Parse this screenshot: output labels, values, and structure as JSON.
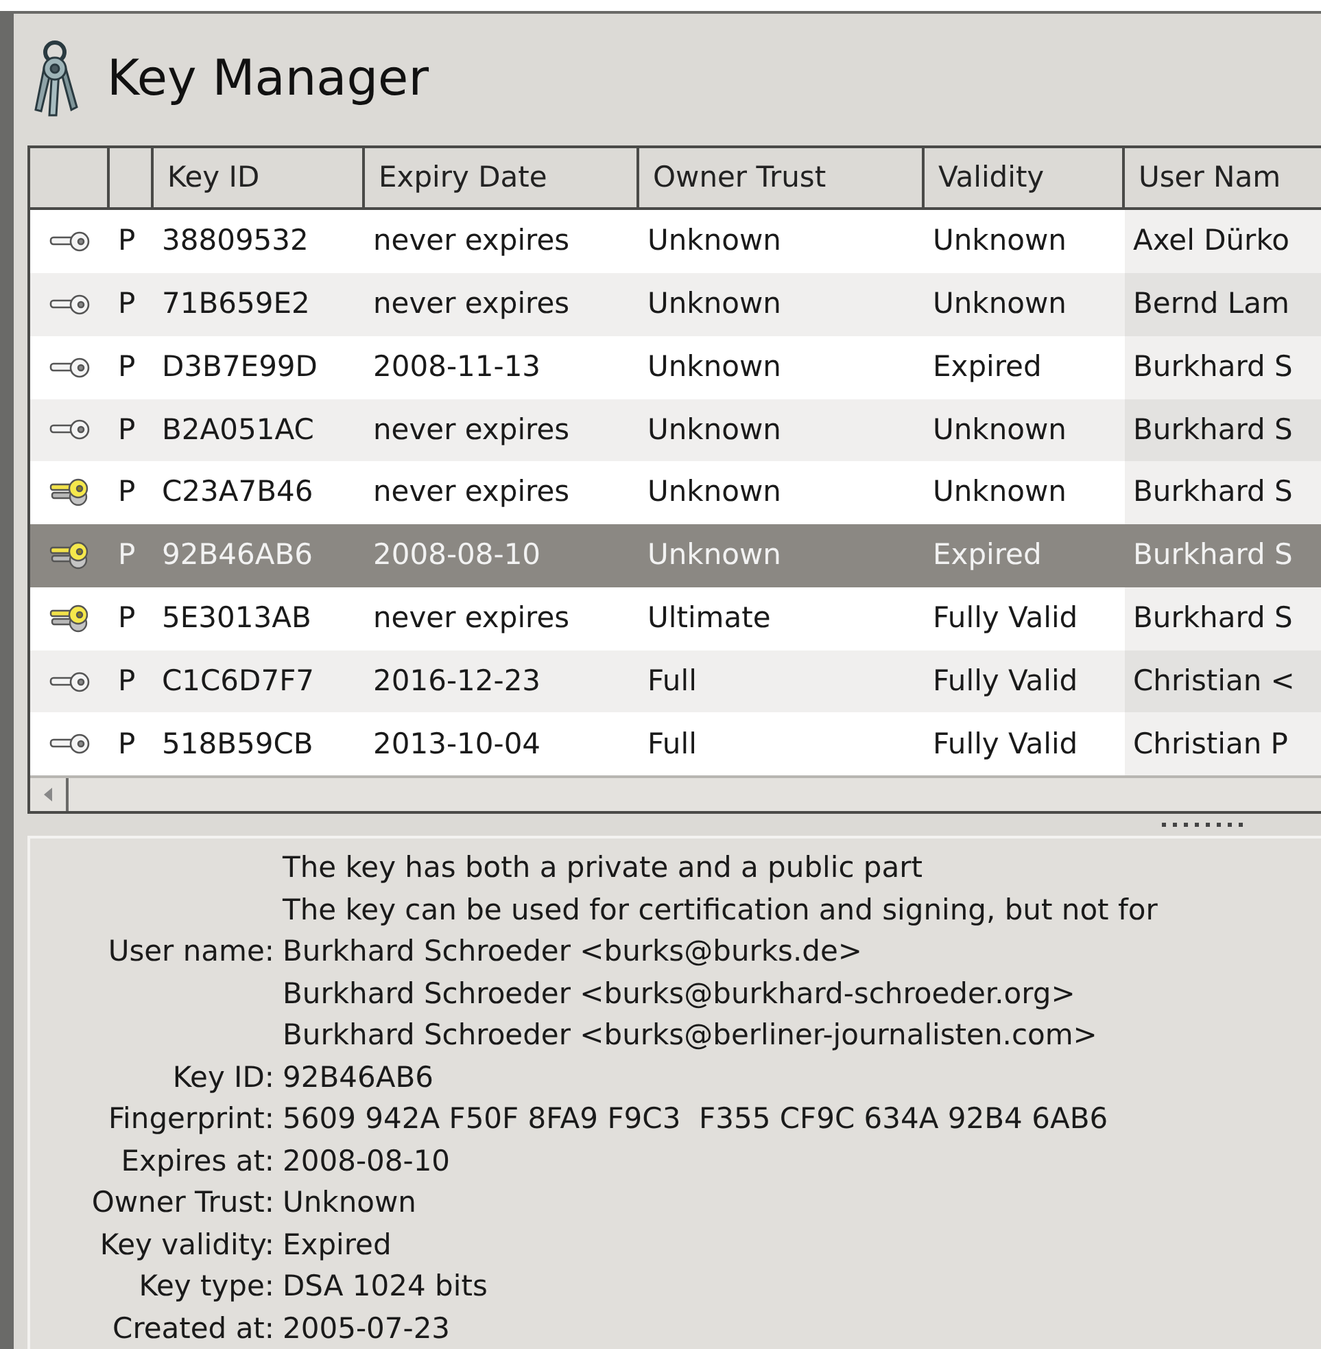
{
  "window": {
    "title": "Key Manager"
  },
  "table": {
    "columns": [
      "Key ID",
      "Expiry Date",
      "Owner Trust",
      "Validity",
      "User Nam"
    ],
    "rows": [
      {
        "kind": "public",
        "type": "P",
        "key_id": "38809532",
        "expiry": "never expires",
        "owner_trust": "Unknown",
        "validity": "Unknown",
        "user_name": "Axel Dürko",
        "selected": false
      },
      {
        "kind": "public",
        "type": "P",
        "key_id": "71B659E2",
        "expiry": "never expires",
        "owner_trust": "Unknown",
        "validity": "Unknown",
        "user_name": "Bernd Lam",
        "selected": false
      },
      {
        "kind": "public",
        "type": "P",
        "key_id": "D3B7E99D",
        "expiry": "2008-11-13",
        "owner_trust": "Unknown",
        "validity": "Expired",
        "user_name": "Burkhard S",
        "selected": false
      },
      {
        "kind": "public",
        "type": "P",
        "key_id": "B2A051AC",
        "expiry": "never expires",
        "owner_trust": "Unknown",
        "validity": "Unknown",
        "user_name": "Burkhard S",
        "selected": false
      },
      {
        "kind": "pair",
        "type": "P",
        "key_id": "C23A7B46",
        "expiry": "never expires",
        "owner_trust": "Unknown",
        "validity": "Unknown",
        "user_name": "Burkhard S",
        "selected": false
      },
      {
        "kind": "pair",
        "type": "P",
        "key_id": "92B46AB6",
        "expiry": "2008-08-10",
        "owner_trust": "Unknown",
        "validity": "Expired",
        "user_name": "Burkhard S",
        "selected": true
      },
      {
        "kind": "pair",
        "type": "P",
        "key_id": "5E3013AB",
        "expiry": "never expires",
        "owner_trust": "Ultimate",
        "validity": "Fully Valid",
        "user_name": "Burkhard S",
        "selected": false
      },
      {
        "kind": "public",
        "type": "P",
        "key_id": "C1C6D7F7",
        "expiry": "2016-12-23",
        "owner_trust": "Full",
        "validity": "Fully Valid",
        "user_name": "Christian <",
        "selected": false
      },
      {
        "kind": "public",
        "type": "P",
        "key_id": "518B59CB",
        "expiry": "2013-10-04",
        "owner_trust": "Full",
        "validity": "Fully Valid",
        "user_name": "Christian P",
        "selected": false
      }
    ]
  },
  "details": [
    {
      "value": "The key has both a private and a public part"
    },
    {
      "value": "The key can be used for certification and signing, but not for"
    },
    {
      "label": "User name:",
      "value": "Burkhard Schroeder <burks@burks.de>"
    },
    {
      "value": "Burkhard Schroeder <burks@burkhard-schroeder.org>"
    },
    {
      "value": "Burkhard Schroeder <burks@berliner-journalisten.com>"
    },
    {
      "label": "Key ID:",
      "value": "92B46AB6"
    },
    {
      "label": "Fingerprint:",
      "value": "5609 942A F50F 8FA9 F9C3  F355 CF9C 634A 92B4 6AB6"
    },
    {
      "label": "Expires at:",
      "value": "2008-08-10"
    },
    {
      "label": "Owner Trust:",
      "value": "Unknown"
    },
    {
      "label": "Key validity:",
      "value": "Expired"
    },
    {
      "label": "Key type:",
      "value": "DSA 1024 bits"
    },
    {
      "label": "Created at:",
      "value": "2005-07-23"
    }
  ]
}
